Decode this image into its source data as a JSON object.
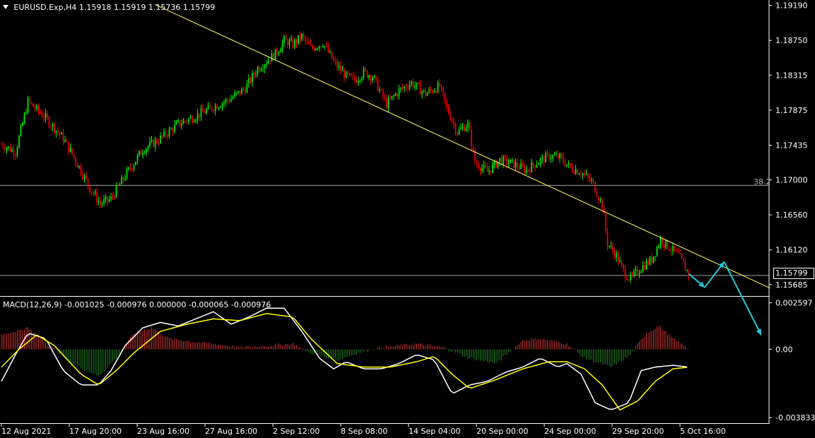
{
  "header": {
    "symbol": "EURUSD.Exp,H4",
    "prices": "1.15918 1.15919 1.15736 1.15799"
  },
  "macd": {
    "label": "MACD(12,26,9) -0.001025 -0.000976 0.000000 -0.000065 -0.000976"
  },
  "price_tag": "1.15799",
  "fib_label": "38.2",
  "colors": {
    "background": "#000000",
    "bull": "#00ff00",
    "bear": "#ff0000",
    "trendline": "#ffff66",
    "level_line": "#a0a0a0",
    "arrow": "#22c7d8",
    "macd_main": "#ffffff",
    "macd_signal": "#ffff00",
    "hist_pos": "#c83232",
    "hist_neg": "#1f7a1f"
  },
  "chart_data": [
    {
      "type": "candlestick",
      "title": "",
      "price_axis_ticks": [
        "1.19190",
        "1.18750",
        "1.18315",
        "1.17875",
        "1.17435",
        "1.17000",
        "1.16560",
        "1.16120",
        "1.15685"
      ],
      "time_axis_ticks": [
        "12 Aug 2021",
        "17 Aug 20:00",
        "23 Aug 16:00",
        "27 Aug 16:00",
        "2 Sep 12:00",
        "8 Sep 08:00",
        "14 Sep 04:00",
        "20 Sep 00:00",
        "24 Sep 00:00",
        "29 Sep 20:00",
        "5 Oct 16:00"
      ],
      "ylim": [
        1.1555,
        1.1924
      ],
      "horizontal_levels": [
        {
          "label": "38.2",
          "value": 1.1693
        },
        {
          "label": "",
          "value": 1.15799
        }
      ],
      "trendline": {
        "from": {
          "bar": 87,
          "price": 1.192
        },
        "to": {
          "bar": 435,
          "price": 1.1564
        }
      },
      "close_path": [
        [
          0,
          1.1745
        ],
        [
          8,
          1.1735
        ],
        [
          15,
          1.1798
        ],
        [
          25,
          1.1778
        ],
        [
          35,
          1.1752
        ],
        [
          45,
          1.1712
        ],
        [
          50,
          1.169
        ],
        [
          56,
          1.167
        ],
        [
          62,
          1.1676
        ],
        [
          70,
          1.1705
        ],
        [
          80,
          1.1738
        ],
        [
          90,
          1.1752
        ],
        [
          100,
          1.177
        ],
        [
          110,
          1.178
        ],
        [
          120,
          1.1792
        ],
        [
          130,
          1.1802
        ],
        [
          138,
          1.1815
        ],
        [
          145,
          1.184
        ],
        [
          155,
          1.1858
        ],
        [
          160,
          1.1875
        ],
        [
          165,
          1.187
        ],
        [
          170,
          1.188
        ],
        [
          175,
          1.1865
        ],
        [
          182,
          1.1872
        ],
        [
          188,
          1.1848
        ],
        [
          195,
          1.183
        ],
        [
          200,
          1.1825
        ],
        [
          205,
          1.1835
        ],
        [
          210,
          1.183
        ],
        [
          218,
          1.1795
        ],
        [
          225,
          1.1812
        ],
        [
          232,
          1.1822
        ],
        [
          240,
          1.1808
        ],
        [
          248,
          1.1818
        ],
        [
          252,
          1.179
        ],
        [
          258,
          1.176
        ],
        [
          264,
          1.177
        ],
        [
          268,
          1.1722
        ],
        [
          275,
          1.171
        ],
        [
          282,
          1.1725
        ],
        [
          290,
          1.172
        ],
        [
          297,
          1.1712
        ],
        [
          303,
          1.1722
        ],
        [
          310,
          1.173
        ],
        [
          316,
          1.1728
        ],
        [
          322,
          1.1715
        ],
        [
          328,
          1.171
        ],
        [
          335,
          1.1695
        ],
        [
          340,
          1.1668
        ],
        [
          343,
          1.162
        ],
        [
          348,
          1.1605
        ],
        [
          352,
          1.1585
        ],
        [
          356,
          1.1575
        ],
        [
          362,
          1.159
        ],
        [
          368,
          1.16
        ],
        [
          373,
          1.1625
        ],
        [
          378,
          1.1615
        ],
        [
          383,
          1.1605
        ],
        [
          389,
          1.1582
        ]
      ],
      "projection_arrows": [
        {
          "from": {
            "bar": 389,
            "price": 1.1582
          },
          "to": {
            "bar": 398,
            "price": 1.1565
          }
        },
        {
          "from": {
            "bar": 398,
            "price": 1.1565
          },
          "to": {
            "bar": 409,
            "price": 1.1597
          }
        },
        {
          "from": {
            "bar": 409,
            "price": 1.1597
          },
          "to": {
            "bar": 430,
            "price": 1.1505
          }
        }
      ],
      "bars": 390
    },
    {
      "type": "line",
      "title": "MACD(12,26,9)",
      "value_axis_ticks": [
        "0.002597",
        "0.00",
        "-0.003833"
      ],
      "ylim": [
        -0.0041,
        0.0029
      ],
      "series": [
        {
          "name": "histogram",
          "points": [
            [
              0,
              0.0008
            ],
            [
              15,
              0.0012
            ],
            [
              25,
              0.0004
            ],
            [
              40,
              -0.0008
            ],
            [
              55,
              -0.0015
            ],
            [
              65,
              -0.0005
            ],
            [
              75,
              0.0009
            ],
            [
              85,
              0.0012
            ],
            [
              95,
              0.0006
            ],
            [
              110,
              0.0004
            ],
            [
              120,
              0.0003
            ],
            [
              135,
              0.0001
            ],
            [
              150,
              0.0002
            ],
            [
              165,
              0.0003
            ],
            [
              175,
              -0.0002
            ],
            [
              190,
              -0.0006
            ],
            [
              205,
              -0.0001
            ],
            [
              215,
              0.0001
            ],
            [
              235,
              0.0003
            ],
            [
              250,
              0.0001
            ],
            [
              265,
              -0.0005
            ],
            [
              280,
              -0.0008
            ],
            [
              295,
              0.0005
            ],
            [
              305,
              0.0006
            ],
            [
              320,
              0.0003
            ],
            [
              330,
              -0.0005
            ],
            [
              345,
              -0.001
            ],
            [
              355,
              -0.0004
            ],
            [
              365,
              0.0009
            ],
            [
              372,
              0.0013
            ],
            [
              380,
              0.0006
            ],
            [
              389,
              0.0
            ]
          ]
        },
        {
          "name": "main",
          "points": [
            [
              0,
              -0.0018
            ],
            [
              8,
              -0.0003
            ],
            [
              15,
              0.0009
            ],
            [
              25,
              0.0006
            ],
            [
              35,
              -0.0012
            ],
            [
              45,
              -0.002
            ],
            [
              55,
              -0.002
            ],
            [
              62,
              -0.0012
            ],
            [
              70,
              0.0002
            ],
            [
              80,
              0.0012
            ],
            [
              90,
              0.0015
            ],
            [
              100,
              0.0013
            ],
            [
              110,
              0.0017
            ],
            [
              120,
              0.0021
            ],
            [
              130,
              0.0014
            ],
            [
              140,
              0.0018
            ],
            [
              150,
              0.0023
            ],
            [
              160,
              0.0023
            ],
            [
              170,
              0.001
            ],
            [
              180,
              -0.0005
            ],
            [
              188,
              -0.0011
            ],
            [
              195,
              -0.0007
            ],
            [
              205,
              -0.0011
            ],
            [
              215,
              -0.0011
            ],
            [
              225,
              -0.0008
            ],
            [
              235,
              -0.0003
            ],
            [
              245,
              -0.0006
            ],
            [
              255,
              -0.0025
            ],
            [
              265,
              -0.002
            ],
            [
              275,
              -0.0018
            ],
            [
              285,
              -0.0013
            ],
            [
              295,
              -0.001
            ],
            [
              305,
              -0.0005
            ],
            [
              315,
              -0.001
            ],
            [
              320,
              -0.0008
            ],
            [
              328,
              -0.0014
            ],
            [
              336,
              -0.003
            ],
            [
              345,
              -0.0034
            ],
            [
              355,
              -0.003
            ],
            [
              362,
              -0.0012
            ],
            [
              370,
              -0.001
            ],
            [
              380,
              -0.0009
            ],
            [
              389,
              -0.001
            ]
          ]
        },
        {
          "name": "signal",
          "points": [
            [
              0,
              -0.001
            ],
            [
              10,
              0.0
            ],
            [
              20,
              0.0008
            ],
            [
              30,
              0.0002
            ],
            [
              45,
              -0.0014
            ],
            [
              55,
              -0.002
            ],
            [
              65,
              -0.0012
            ],
            [
              75,
              -0.0002
            ],
            [
              90,
              0.001
            ],
            [
              105,
              0.0014
            ],
            [
              120,
              0.0017
            ],
            [
              135,
              0.0016
            ],
            [
              150,
              0.002
            ],
            [
              165,
              0.0018
            ],
            [
              175,
              0.0006
            ],
            [
              190,
              -0.0008
            ],
            [
              205,
              -0.001
            ],
            [
              220,
              -0.001
            ],
            [
              235,
              -0.0007
            ],
            [
              245,
              -0.0004
            ],
            [
              255,
              -0.0014
            ],
            [
              265,
              -0.0022
            ],
            [
              280,
              -0.0017
            ],
            [
              295,
              -0.0011
            ],
            [
              310,
              -0.0007
            ],
            [
              320,
              -0.0007
            ],
            [
              330,
              -0.0011
            ],
            [
              340,
              -0.002
            ],
            [
              350,
              -0.0034
            ],
            [
              360,
              -0.0029
            ],
            [
              370,
              -0.0018
            ],
            [
              380,
              -0.0011
            ],
            [
              389,
              -0.001
            ]
          ]
        }
      ]
    }
  ]
}
